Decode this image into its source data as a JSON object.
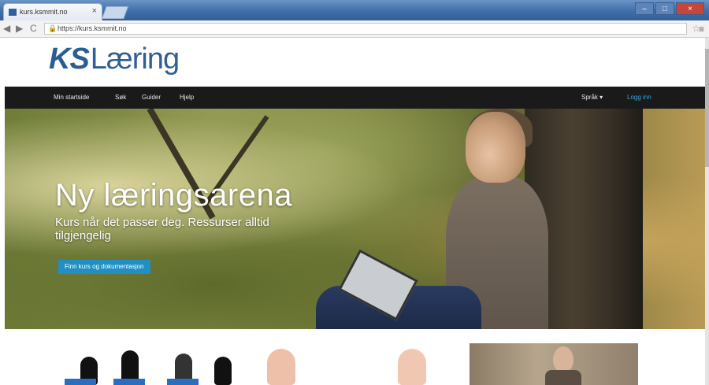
{
  "browser": {
    "tab_title": "kurs.ksmmit.no",
    "tab_close": "×",
    "url": "https://kurs.ksmmit.no",
    "nav_back": "◀",
    "nav_forward": "▶",
    "nav_reload": "C",
    "lock": "🔒",
    "star": "☆",
    "menu": "≡",
    "win_min": "–",
    "win_max": "□",
    "win_close": "×"
  },
  "site": {
    "logo_ks": "KS",
    "logo_text": "Læring"
  },
  "nav": {
    "items": [
      "Min startside",
      "Søk",
      "Guider",
      "Hjelp"
    ],
    "language": "Språk ▾",
    "login": "Logg inn"
  },
  "hero": {
    "title": "Ny læringsarena",
    "subtitle": "Kurs når det passer deg. Ressurser alltid tilgjengelig",
    "button": "Finn kurs og dokumentasjon"
  },
  "colors": {
    "accent": "#1f8fc4",
    "navbar": "#1a1a1a",
    "logo": "#2b5d95",
    "login": "#3ba6d9"
  }
}
